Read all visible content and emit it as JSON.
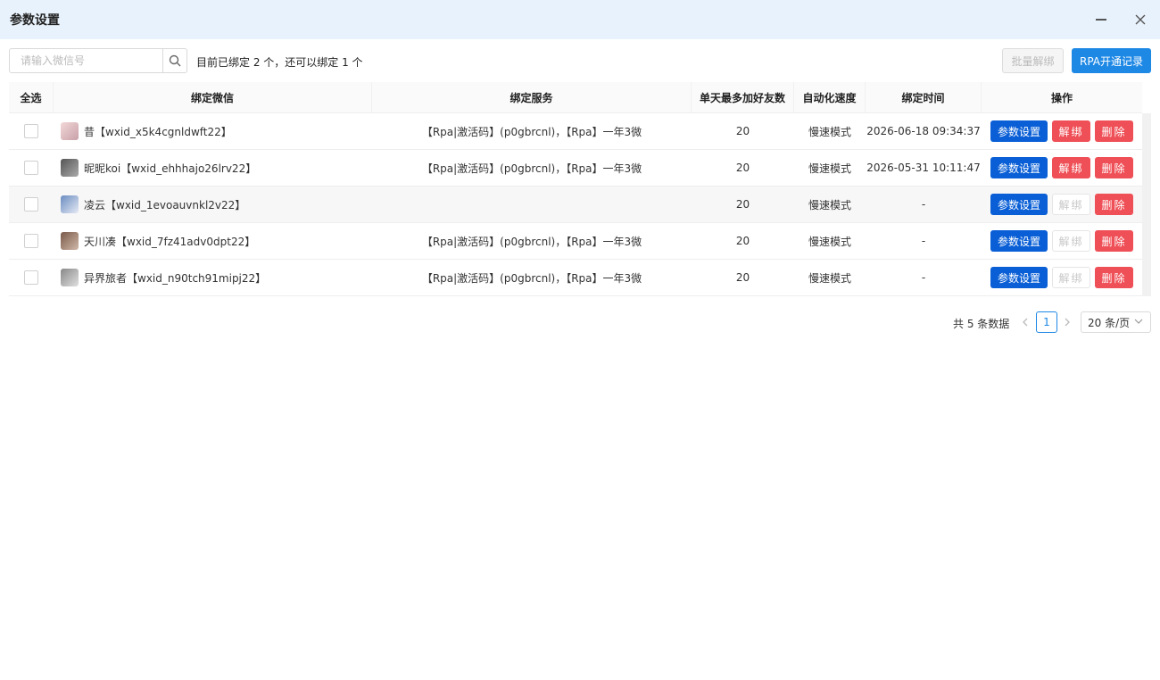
{
  "window": {
    "title": "参数设置"
  },
  "toolbar": {
    "search_placeholder": "请输入微信号",
    "bind_info": "目前已绑定 2 个，还可以绑定 1 个",
    "batch_unbind_label": "批量解绑",
    "rpa_record_label": "RPA开通记录"
  },
  "table": {
    "headers": [
      "全选",
      "绑定微信",
      "绑定服务",
      "单天最多加好友数",
      "自动化速度",
      "绑定时间",
      "操作"
    ],
    "rows": [
      {
        "wechat": "昔【wxid_x5k4cgnldwft22】",
        "service": "【Rpa|激活码】(p0gbrcnl)，【Rpa】一年3微",
        "max_friends": "20",
        "speed": "慢速模式",
        "bind_time": "2026-06-18 09:34:37",
        "unbind_enabled": true
      },
      {
        "wechat": "昵昵koi【wxid_ehhhajo26lrv22】",
        "service": "【Rpa|激活码】(p0gbrcnl)，【Rpa】一年3微",
        "max_friends": "20",
        "speed": "慢速模式",
        "bind_time": "2026-05-31 10:11:47",
        "unbind_enabled": true
      },
      {
        "wechat": "凌云【wxid_1evoauvnkl2v22】",
        "service": "",
        "max_friends": "20",
        "speed": "慢速模式",
        "bind_time": "-",
        "unbind_enabled": false
      },
      {
        "wechat": "天川凑【wxid_7fz41adv0dpt22】",
        "service": "【Rpa|激活码】(p0gbrcnl)，【Rpa】一年3微",
        "max_friends": "20",
        "speed": "慢速模式",
        "bind_time": "-",
        "unbind_enabled": false
      },
      {
        "wechat": "异界旅者【wxid_n90tch91mipj22】",
        "service": "【Rpa|激活码】(p0gbrcnl)，【Rpa】一年3微",
        "max_friends": "20",
        "speed": "慢速模式",
        "bind_time": "-",
        "unbind_enabled": false
      }
    ],
    "actions": {
      "settings_label": "参数设置",
      "unbind_label": "解绑",
      "delete_label": "删除"
    }
  },
  "pagination": {
    "total_text": "共 5 条数据",
    "current_page": "1",
    "page_size": "20 条/页"
  },
  "colors": {
    "titlebar_bg": "#e8f2fc",
    "primary": "#0a5fd6",
    "accent_blue": "#1e88e5",
    "danger": "#ef4f56"
  },
  "icons": {
    "minimize": "minimize-icon",
    "close": "close-icon",
    "search": "search-icon",
    "prev": "chevron-left-icon",
    "next": "chevron-right-icon",
    "dropdown": "chevron-down-icon"
  }
}
